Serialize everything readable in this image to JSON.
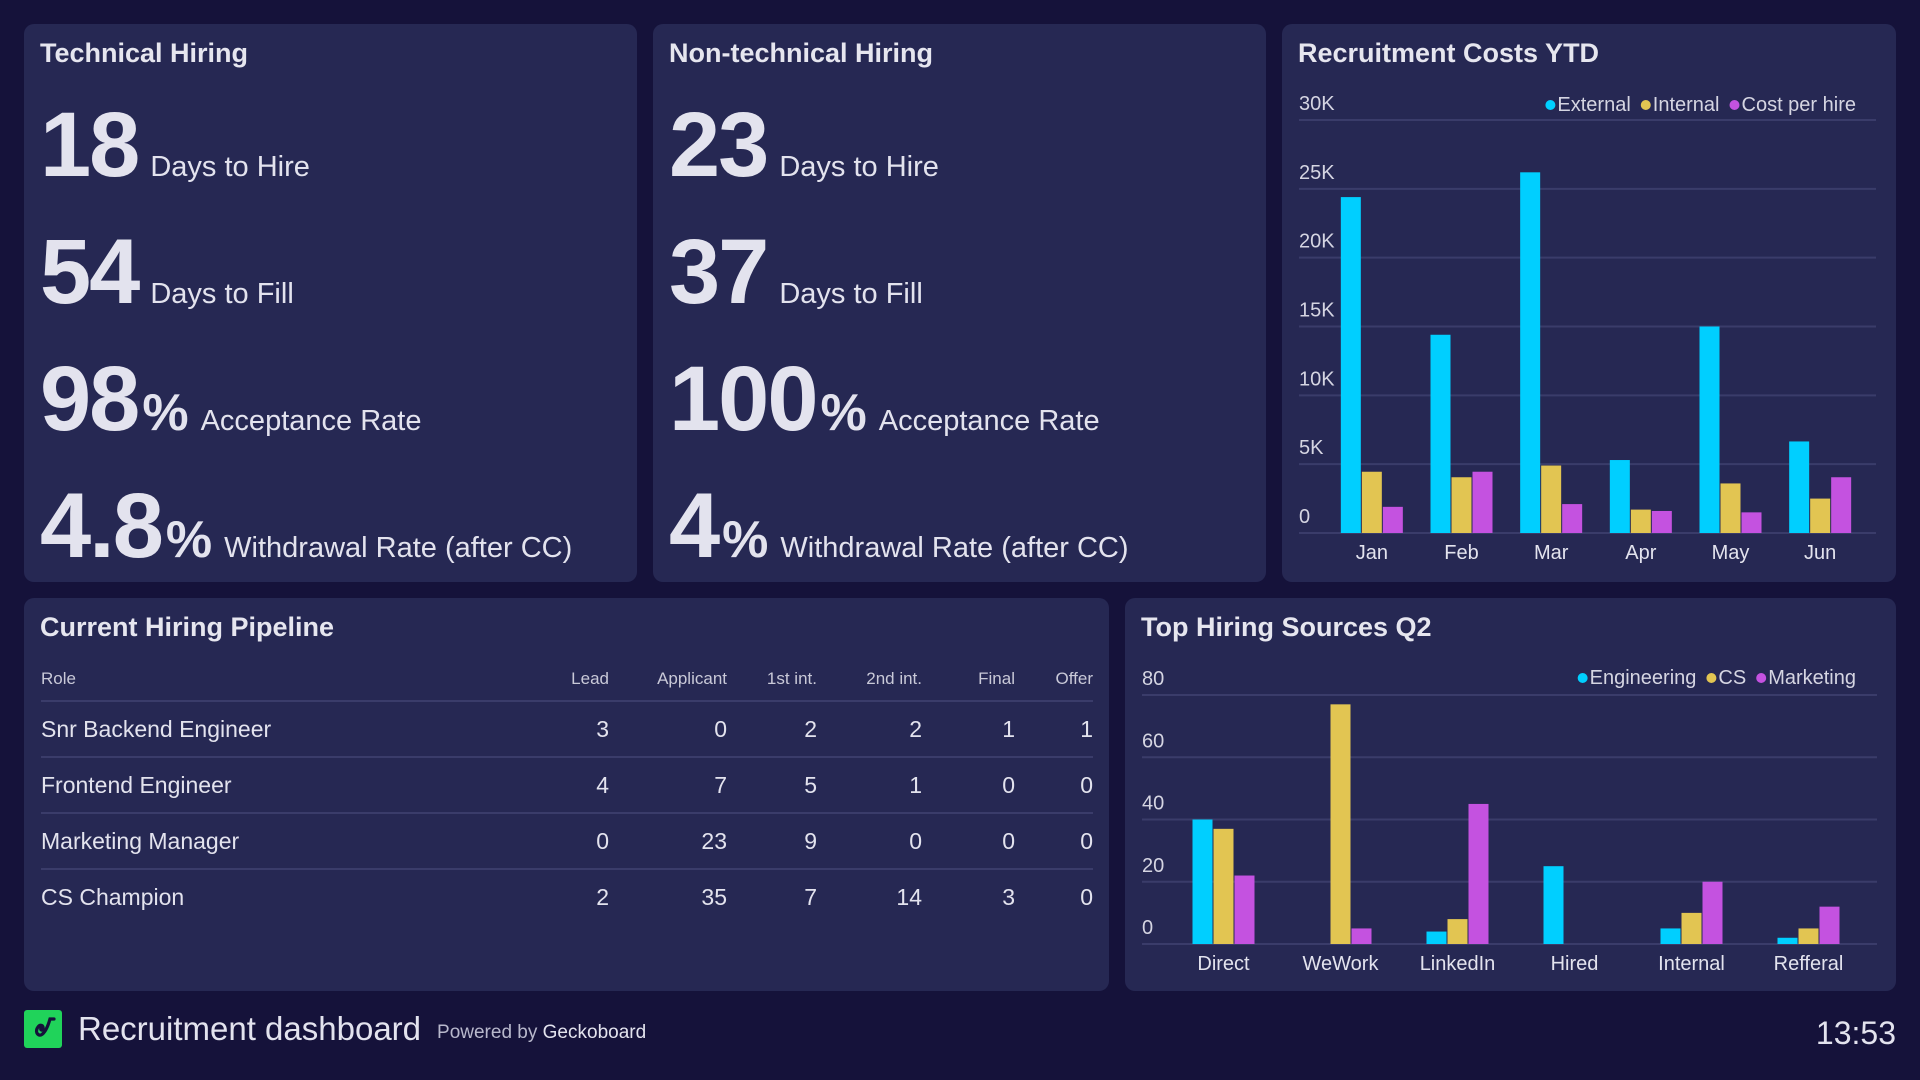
{
  "colors": {
    "external": "#00cfff",
    "internal": "#e2c552",
    "cost_per_hire": "#c452e0",
    "engineering": "#00cfff",
    "cs": "#e2c552",
    "marketing": "#c452e0"
  },
  "technical": {
    "title": "Technical Hiring",
    "kpis": [
      {
        "value": "18",
        "unit": "",
        "label": "Days to Hire"
      },
      {
        "value": "54",
        "unit": "",
        "label": "Days to Fill"
      },
      {
        "value": "98",
        "unit": "%",
        "label": "Acceptance Rate"
      },
      {
        "value": "4.8",
        "unit": "%",
        "label": "Withdrawal Rate (after CC)"
      }
    ]
  },
  "nontechnical": {
    "title": "Non-technical Hiring",
    "kpis": [
      {
        "value": "23",
        "unit": "",
        "label": "Days to Hire"
      },
      {
        "value": "37",
        "unit": "",
        "label": "Days to Fill"
      },
      {
        "value": "100",
        "unit": "%",
        "label": "Acceptance Rate"
      },
      {
        "value": "4",
        "unit": "%",
        "label": "Withdrawal Rate (after CC)"
      }
    ]
  },
  "pipeline": {
    "title": "Current Hiring Pipeline",
    "columns": [
      "Role",
      "Lead",
      "Applicant",
      "1st int.",
      "2nd int.",
      "Final",
      "Offer"
    ],
    "rows": [
      [
        "Snr Backend Engineer",
        "3",
        "0",
        "2",
        "2",
        "1",
        "1"
      ],
      [
        "Frontend Engineer",
        "4",
        "7",
        "5",
        "1",
        "0",
        "0"
      ],
      [
        "Marketing Manager",
        "0",
        "23",
        "9",
        "0",
        "0",
        "0"
      ],
      [
        "CS Champion",
        "2",
        "35",
        "7",
        "14",
        "3",
        "0"
      ]
    ]
  },
  "chart_data": [
    {
      "type": "bar",
      "title": "Recruitment Costs YTD",
      "categories": [
        "Jan",
        "Feb",
        "Mar",
        "Apr",
        "May",
        "Jun"
      ],
      "series": [
        {
          "name": "External",
          "color": "#00cfff",
          "values": [
            24400,
            14400,
            26200,
            5300,
            15000,
            6650
          ]
        },
        {
          "name": "Internal",
          "color": "#e2c552",
          "values": [
            4450,
            4050,
            4900,
            1700,
            3600,
            2500
          ]
        },
        {
          "name": "Cost per hire",
          "color": "#c452e0",
          "values": [
            1900,
            4450,
            2100,
            1600,
            1500,
            4050
          ]
        }
      ],
      "yticks": [
        0,
        5000,
        10000,
        15000,
        20000,
        25000,
        30000
      ],
      "ytick_labels": [
        "0",
        "5K",
        "10K",
        "15K",
        "20K",
        "25K",
        "30K"
      ],
      "ylim": [
        0,
        30000
      ],
      "xlabel": "",
      "ylabel": "",
      "grid": true,
      "legend": "top-right"
    },
    {
      "type": "bar",
      "title": "Top Hiring Sources Q2",
      "categories": [
        "Direct",
        "WeWork",
        "LinkedIn",
        "Hired",
        "Internal",
        "Refferal"
      ],
      "series": [
        {
          "name": "Engineering",
          "color": "#00cfff",
          "values": [
            40,
            0,
            4,
            25,
            5,
            2
          ]
        },
        {
          "name": "CS",
          "color": "#e2c552",
          "values": [
            37,
            77,
            8,
            0,
            10,
            5
          ]
        },
        {
          "name": "Marketing",
          "color": "#c452e0",
          "values": [
            22,
            5,
            45,
            0,
            20,
            12
          ]
        }
      ],
      "yticks": [
        0,
        20,
        40,
        60,
        80
      ],
      "ytick_labels": [
        "0",
        "20",
        "40",
        "60",
        "80"
      ],
      "ylim": [
        0,
        80
      ],
      "xlabel": "",
      "ylabel": "",
      "grid": true,
      "legend": "top-right"
    }
  ],
  "footer": {
    "title": "Recruitment dashboard",
    "powered_prefix": "Powered by",
    "powered_brand": "Geckoboard",
    "logo_icon": "geckoboard-logo-icon",
    "time": "13:53"
  }
}
